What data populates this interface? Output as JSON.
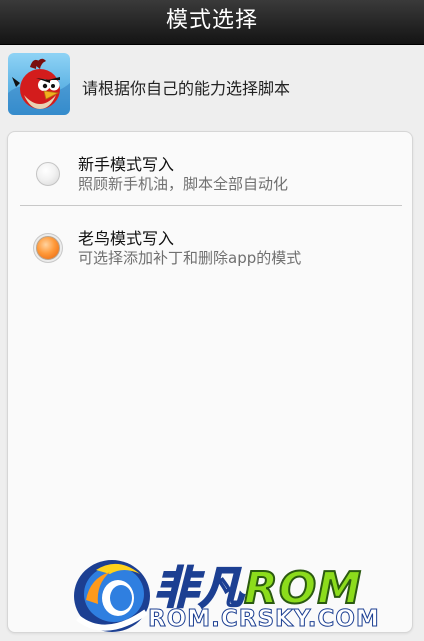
{
  "title_bar": {
    "title": "模式选择"
  },
  "header": {
    "icon": "angry-bird-app-icon",
    "text": "请根据你自己的能力选择脚本"
  },
  "options": [
    {
      "title": "新手模式写入",
      "subtitle": "照顾新手机油，脚本全部自动化",
      "selected": false
    },
    {
      "title": "老鸟模式写入",
      "subtitle": "可选择添加补丁和删除app的模式",
      "selected": true
    }
  ],
  "watermark": {
    "brand_cn": "非凡",
    "brand_rom": "ROM",
    "url": "ROM.CRSKY.COM"
  },
  "colors": {
    "title_bar_bg": "#1f1f1f",
    "radio_selected": "#ff8a1a",
    "watermark_blue": "#1c3f92",
    "watermark_green": "#8cdc1c"
  }
}
